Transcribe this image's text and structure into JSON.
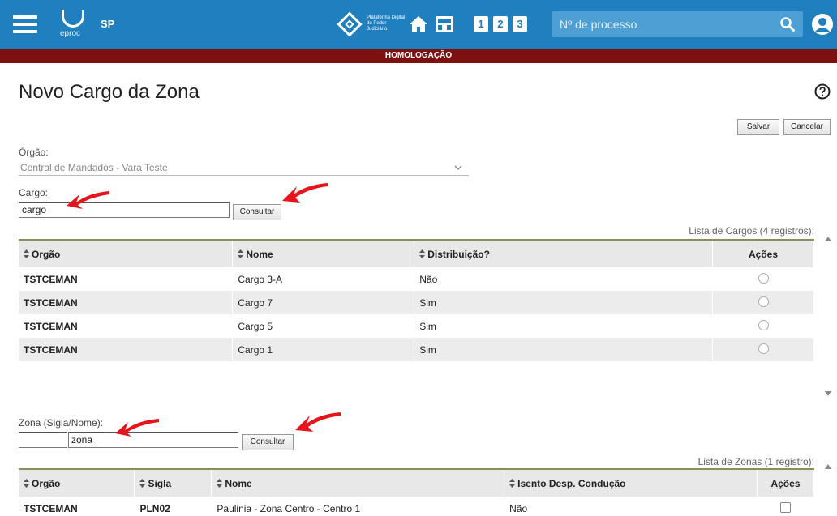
{
  "topbar": {
    "logo_text": "eproc",
    "state": "SP",
    "platform_logo_text": "Plataforma Digital do Poder Judiciário",
    "num_buttons": [
      "1",
      "2",
      "3"
    ],
    "search_placeholder": "Nº de processo",
    "bar_color": "#1f7fbf"
  },
  "env_banner": {
    "label": "HOMOLOGAÇÃO",
    "color": "#7d1010"
  },
  "page": {
    "title": "Novo Cargo da Zona",
    "save_button": "Salvar",
    "cancel_button": "Cancelar"
  },
  "orgao": {
    "label": "Órgão:",
    "selected": "Central de Mandados - Vara Teste"
  },
  "cargo": {
    "label": "Cargo:",
    "value": "cargo",
    "consult_button": "Consultar",
    "list_caption": "Lista de Cargos (4 registros):",
    "columns": [
      "Orgão",
      "Nome",
      "Distribuição?",
      "Ações"
    ],
    "rows": [
      {
        "orgao": "TSTCEMAN",
        "nome": "Cargo 3-A",
        "distribuicao": "Não"
      },
      {
        "orgao": "TSTCEMAN",
        "nome": "Cargo 7",
        "distribuicao": "Sim"
      },
      {
        "orgao": "TSTCEMAN",
        "nome": "Cargo 5",
        "distribuicao": "Sim"
      },
      {
        "orgao": "TSTCEMAN",
        "nome": "Cargo 1",
        "distribuicao": "Sim"
      }
    ]
  },
  "zona": {
    "label": "Zona (Sigla/Nome):",
    "sigla_value": "",
    "nome_value": "zona",
    "consult_button": "Consultar",
    "list_caption": "Lista de Zonas (1 registro):",
    "columns": [
      "Orgão",
      "Sigla",
      "Nome",
      "Isento Desp. Condução",
      "Ações"
    ],
    "rows": [
      {
        "orgao": "TSTCEMAN",
        "sigla": "PLN02",
        "nome": "Paulinia - Zona Centro - Centro 1",
        "isento": "Não"
      }
    ]
  },
  "annotation_color": "#e8141c"
}
